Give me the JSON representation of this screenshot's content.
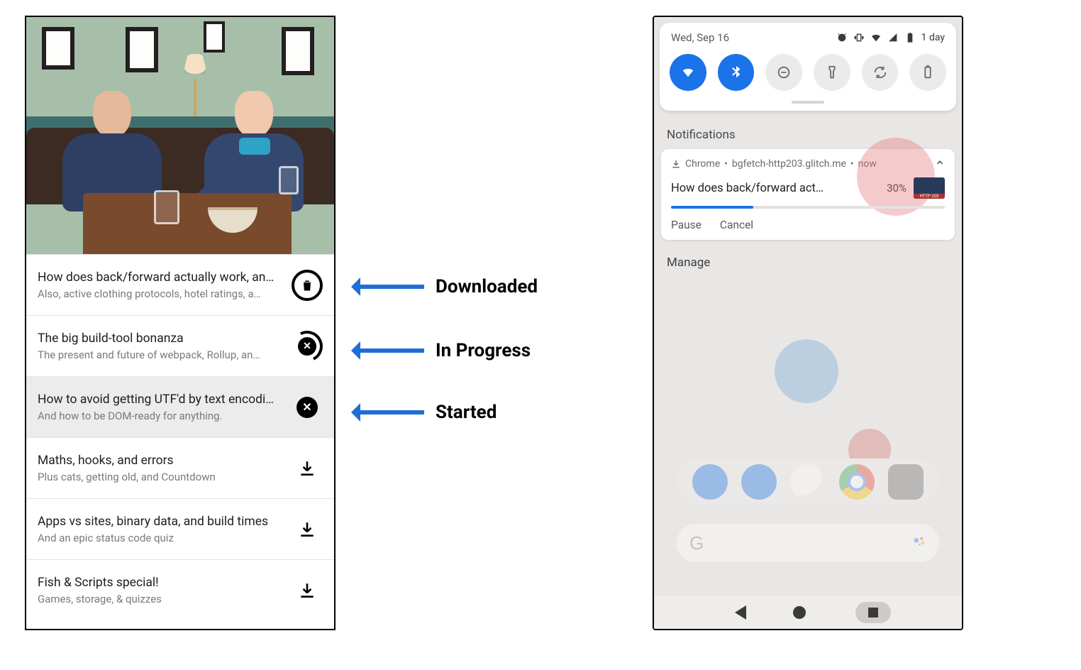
{
  "annotations": {
    "downloaded": "Downloaded",
    "in_progress": "In Progress",
    "started": "Started"
  },
  "app": {
    "items": [
      {
        "title": "How does back/forward actually work, an…",
        "subtitle": "Also, active clothing protocols, hotel ratings, a…",
        "state": "downloaded"
      },
      {
        "title": "The big build-tool bonanza",
        "subtitle": "The present and future of webpack, Rollup, an…",
        "state": "in_progress"
      },
      {
        "title": "How to avoid getting UTF'd by text encodi…",
        "subtitle": "And how to be DOM-ready for anything.",
        "state": "started"
      },
      {
        "title": "Maths, hooks, and errors",
        "subtitle": "Plus cats, getting old, and Countdown",
        "state": "idle"
      },
      {
        "title": "Apps vs sites, binary data, and build times",
        "subtitle": "And an epic status code quiz",
        "state": "idle"
      },
      {
        "title": "Fish & Scripts special!",
        "subtitle": "Games, storage, & quizzes",
        "state": "idle"
      }
    ]
  },
  "android": {
    "date": "Wed, Sep 16",
    "battery_label": "1 day",
    "notifications_header": "Notifications",
    "notification": {
      "app": "Chrome",
      "source": "bgfetch-http203.glitch.me",
      "time": "now",
      "title": "How does back/forward act…",
      "percent_label": "30%",
      "percent_value": 30,
      "actions": {
        "pause": "Pause",
        "cancel": "Cancel"
      }
    },
    "manage": "Manage",
    "search_letter": "G"
  }
}
